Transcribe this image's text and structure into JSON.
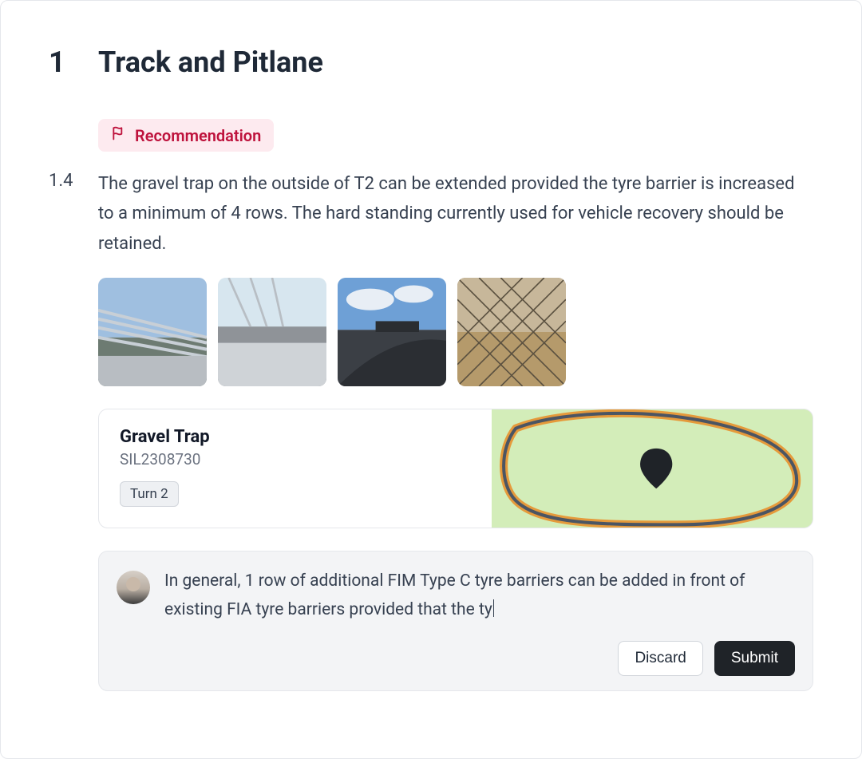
{
  "section": {
    "number": "1",
    "title": "Track and Pitlane"
  },
  "badge": {
    "label": "Recommendation"
  },
  "item": {
    "number": "1.4",
    "text": "The gravel trap on the outside of T2 can be extended provided the tyre barrier is increased to a minimum of 4 rows. The hard standing currently used for vehicle recovery should be retained."
  },
  "thumbnails": [
    {
      "name": "track-photo-1"
    },
    {
      "name": "track-photo-2"
    },
    {
      "name": "track-photo-3"
    },
    {
      "name": "track-photo-4"
    }
  ],
  "location": {
    "title": "Gravel Trap",
    "code": "SIL2308730",
    "tag": "Turn 2"
  },
  "comment": {
    "text": "In general, 1 row of additional FIM Type C tyre barriers can be added in front of existing FIA tyre barriers provided that the ty"
  },
  "actions": {
    "discard": "Discard",
    "submit": "Submit"
  }
}
